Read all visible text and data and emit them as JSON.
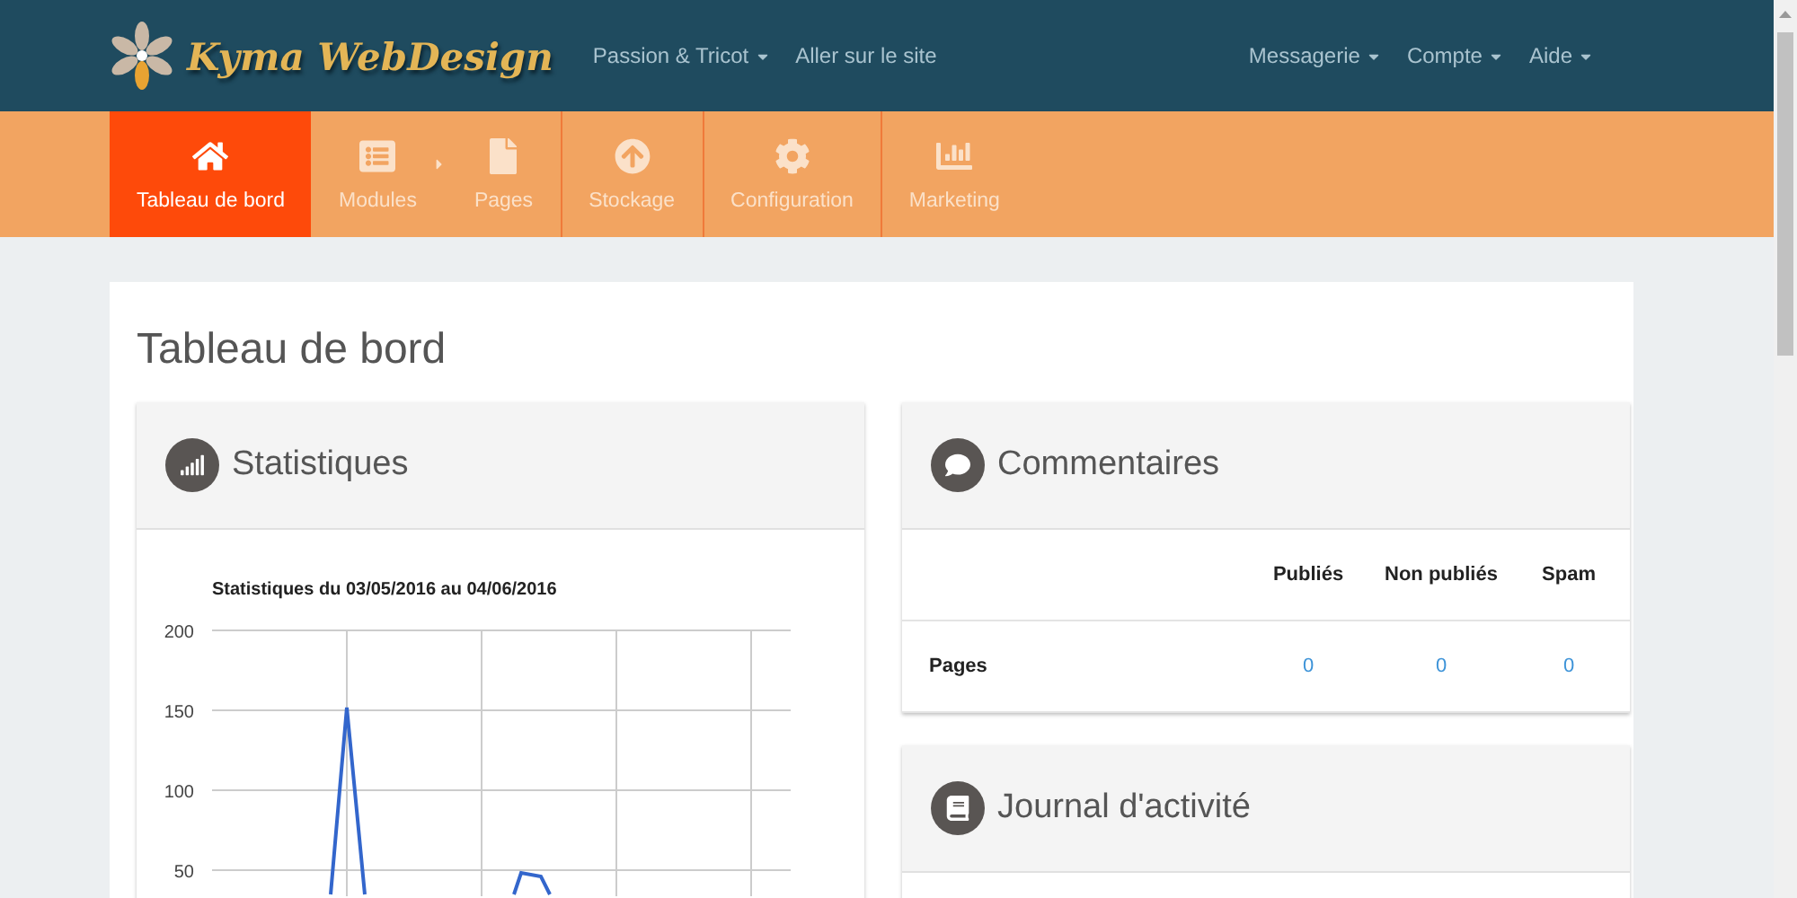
{
  "header": {
    "logo_text": "Kyma WebDesign",
    "left_menu": [
      {
        "label": "Passion & Tricot",
        "dropdown": true
      },
      {
        "label": "Aller sur le site",
        "dropdown": false
      }
    ],
    "right_menu": [
      {
        "label": "Messagerie",
        "dropdown": true
      },
      {
        "label": "Compte",
        "dropdown": true
      },
      {
        "label": "Aide",
        "dropdown": true
      }
    ]
  },
  "nav": {
    "items": [
      {
        "label": "Tableau de bord",
        "kind": "home",
        "selected": true,
        "expanded": false
      },
      {
        "label": "Modules",
        "kind": "list",
        "selected": false,
        "expanded": true
      },
      {
        "label": "Pages",
        "kind": "file",
        "selected": false,
        "expanded": false
      },
      {
        "label": "Stockage",
        "kind": "upload",
        "selected": false,
        "expanded": false
      },
      {
        "label": "Configuration",
        "kind": "gear",
        "selected": false,
        "expanded": false
      },
      {
        "label": "Marketing",
        "kind": "chart",
        "selected": false,
        "expanded": false
      }
    ]
  },
  "page_title": "Tableau de bord",
  "statistics": {
    "title": "Statistiques",
    "chart_title": "Statistiques du 03/05/2016 au 04/06/2016",
    "y_tick_labels": [
      "200",
      "150",
      "100",
      "50"
    ]
  },
  "comments": {
    "title": "Commentaires",
    "columns": [
      "Publiés",
      "Non publiés",
      "Spam"
    ],
    "rows": [
      {
        "label": "Pages",
        "values": [
          "0",
          "0",
          "0"
        ]
      }
    ]
  },
  "activity": {
    "title": "Journal d'activité"
  }
}
